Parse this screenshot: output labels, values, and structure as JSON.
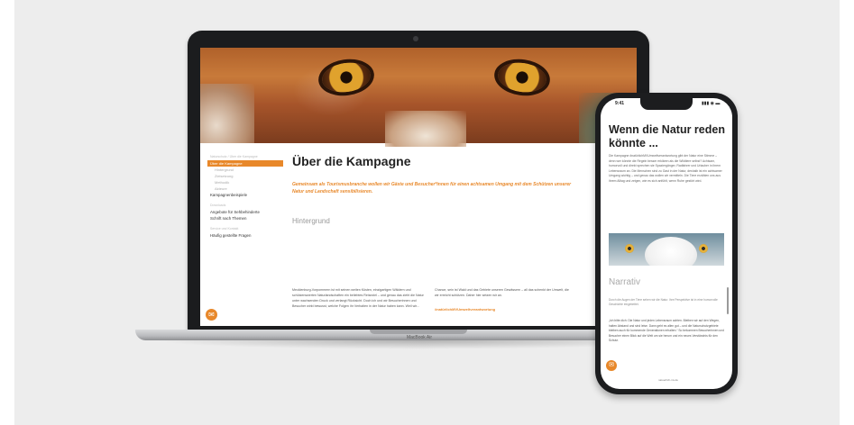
{
  "colors": {
    "accent": "#e8882a",
    "backdrop": "#ededed"
  },
  "laptop": {
    "brand_label": "MacBook Air",
    "sidebar": {
      "breadcrumb": "Naturschutz / Über die Kampagne",
      "items": [
        {
          "label": "Über die Kampagne",
          "style": "active"
        },
        {
          "label": "Hintergrund",
          "style": "sub"
        },
        {
          "label": "Zielsetzung",
          "style": "sub"
        },
        {
          "label": "Methodik",
          "style": "sub"
        },
        {
          "label": "Akteure",
          "style": "sub"
        },
        {
          "label": "Kampagnenbeispiele",
          "style": "dark"
        },
        {
          "label": "",
          "style": "gap"
        },
        {
          "label": "Downloads",
          "style": "head"
        },
        {
          "label": "Angebote für Sehbehinderte",
          "style": "dark"
        },
        {
          "label": "Schrift nach Themen",
          "style": "dark"
        },
        {
          "label": "",
          "style": "gap"
        },
        {
          "label": "Service und Kontakt",
          "style": "head"
        },
        {
          "label": "Häufig gestellte Fragen",
          "style": "dark"
        }
      ],
      "chat_icon": "chat-icon"
    },
    "page": {
      "title": "Über die Kampagne",
      "intro": "Gemeinsam als Tourismusbranche wollen wir Gäste und Besucher*innen für einen achtsamen Umgang mit dem Schützen unserer Natur und Landschaft sensibilisieren.",
      "section_label": "Hintergrund",
      "col1": "Mecklenburg-Vorpommern ist mit seinen weiten Küsten, einzigartigen Wäldern und schützenswerten Naturlandschaften ein beliebtes Reiseziel – und genau das zieht die Natur unter wachsenden Druck und verlangt Rücksicht. Doch ich und wir Besucherinnen und Besucher wirkt bewusst, welche Folgen ihr Verhalten in der Natur haben kann. Weil wir...",
      "col2": "Chance, sein ist Wald und das Gebiete unseren Gewässern – all das schenkt der Umwelt, die wir erreicht schützen. Daher hier setzen wir an.",
      "hashtag": "#natürlichMVUmweltverantwortung"
    }
  },
  "phone": {
    "status_time": "9:41",
    "status_icons": "▮▮▮ ◉ ▬",
    "title": "Wenn die Natur reden könnte ...",
    "intro_text": "Die Kampagne #natürlichMVUmweltverantwortung gibt der Natur eine Stimme – denn wer könnte die Regeln besser erklären als die Wildtiere selbst? Achtsam, humorvoll und direkt sprechen sie Spaziergänger, Radfahrer und Urlauber in ihrem Lebensraum an. Die Menschen sind zu Gast in der Natur, deshalb ist ein achtsamer Umgang wichtig – und genau das wollen wir vermitteln. Die Tiere erzählen uns aus ihrem Alltag und zeigen, wie es sich anfühlt, wenn Ruhe gestört wird.",
    "subtitle": "Narrativ",
    "text2": "Durch die Augen der Tiere sehen wir die Natur. Ihre Perspektive ist in eine humorvolle Geschichte eingebettet.",
    "text3": "„Ich bitte dich: Die Natur und jeden Lebensraum achten. Bleiben wir auf den Wegen, halten Abstand und sind leise. Dann geht es allen gut – und die Naturschutzgebiete bleiben auch für kommende Generationen erhalten.“ So bekommen Besucherinnen und Besucher einen Blick auf die Welt um sie herum und ein neues Verständnis für den Schutz.",
    "chat_icon": "chat-icon",
    "url": "natuerlich-mv.de"
  }
}
